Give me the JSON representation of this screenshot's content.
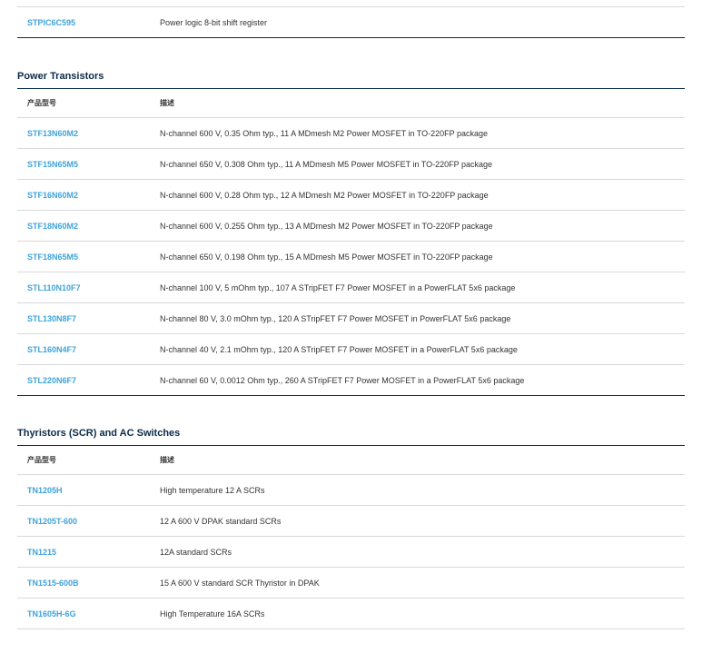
{
  "previous_table": {
    "rows": [
      {
        "part": "STPIC6C595",
        "desc": "Power logic 8-bit shift register"
      }
    ]
  },
  "power_transistors": {
    "title": "Power Transistors",
    "col_part": "产品型号",
    "col_desc": "描述",
    "rows": [
      {
        "part": "STF13N60M2",
        "desc": "N-channel 600 V, 0.35 Ohm typ., 11 A MDmesh M2 Power MOSFET in TO-220FP package"
      },
      {
        "part": "STF15N65M5",
        "desc": "N-channel 650 V, 0.308 Ohm typ., 11 A MDmesh M5 Power MOSFET in TO-220FP package"
      },
      {
        "part": "STF16N60M2",
        "desc": "N-channel 600 V, 0.28 Ohm typ., 12 A MDmesh M2 Power MOSFET in TO-220FP package"
      },
      {
        "part": "STF18N60M2",
        "desc": "N-channel 600 V, 0.255 Ohm typ., 13 A MDmesh M2 Power MOSFET in TO-220FP package"
      },
      {
        "part": "STF18N65M5",
        "desc": "N-channel 650 V, 0.198 Ohm typ., 15 A MDmesh M5 Power MOSFET in TO-220FP package"
      },
      {
        "part": "STL110N10F7",
        "desc": "N-channel 100 V, 5 mOhm typ., 107 A STripFET F7 Power MOSFET in a PowerFLAT 5x6 package"
      },
      {
        "part": "STL130N8F7",
        "desc": "N-channel 80 V, 3.0 mOhm typ., 120 A STripFET F7 Power MOSFET in PowerFLAT 5x6 package"
      },
      {
        "part": "STL160N4F7",
        "desc": "N-channel 40 V, 2.1 mOhm typ., 120 A STripFET F7 Power MOSFET in a PowerFLAT 5x6 package"
      },
      {
        "part": "STL220N6F7",
        "desc": "N-channel 60 V, 0.0012 Ohm typ., 260 A STripFET F7 Power MOSFET in a PowerFLAT 5x6 package"
      }
    ]
  },
  "thyristors": {
    "title": "Thyristors (SCR) and AC Switches",
    "col_part": "产品型号",
    "col_desc": "描述",
    "rows": [
      {
        "part": "TN1205H",
        "desc": "High temperature 12 A SCRs"
      },
      {
        "part": "TN1205T-600",
        "desc": "12 A 600 V DPAK standard SCRs"
      },
      {
        "part": "TN1215",
        "desc": "12A standard SCRs"
      },
      {
        "part": "TN1515-600B",
        "desc": "15 A 600 V standard SCR Thyristor in DPAK"
      },
      {
        "part": "TN1605H-6G",
        "desc": "High Temperature 16A SCRs"
      }
    ]
  },
  "colors": {
    "link": "#3ea3d9",
    "heading": "#0b2b4a",
    "rule": "#d9d9d9"
  }
}
